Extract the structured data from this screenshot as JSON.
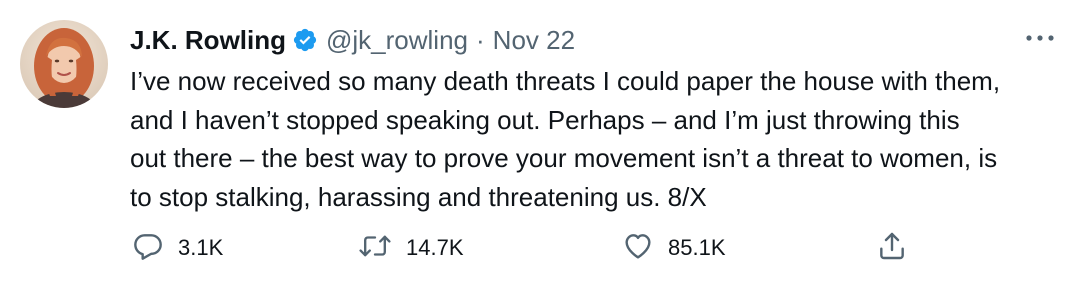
{
  "author": {
    "display_name": "J.K. Rowling",
    "handle": "@jk_rowling",
    "separator": "·",
    "date": "Nov 22",
    "verified": true,
    "verified_color": "#1d9bf0"
  },
  "tweet": {
    "lines": [
      "I’ve now received so many death threats I could paper the house with them,",
      "and I haven’t stopped speaking out. Perhaps – and I’m just throwing this",
      "out there – the best way to prove your movement isn’t a threat to women, is",
      "to stop stalking, harassing and threatening us. 8/X"
    ]
  },
  "actions": {
    "reply": {
      "icon": "reply-icon",
      "count": "3.1K"
    },
    "retweet": {
      "icon": "retweet-icon",
      "count": "14.7K"
    },
    "like": {
      "icon": "like-icon",
      "count": "85.1K"
    },
    "share": {
      "icon": "share-icon"
    }
  },
  "more_icon": "more-icon"
}
